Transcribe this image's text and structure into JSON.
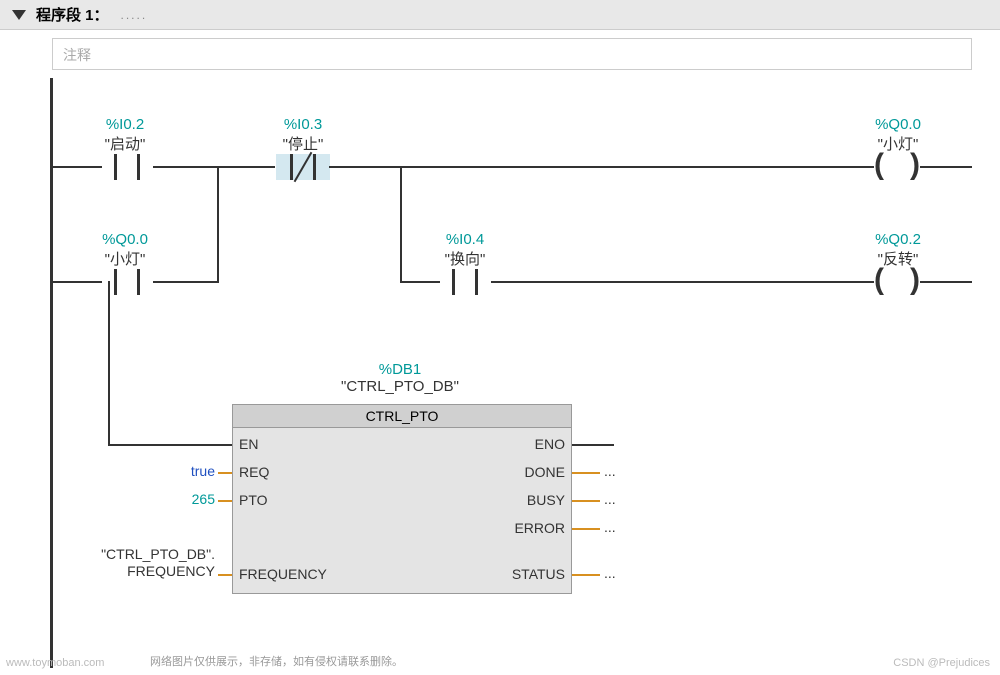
{
  "header": {
    "title": "程序段 1：",
    "dots": "....."
  },
  "comment_placeholder": "注释",
  "rung1": {
    "c1": {
      "addr": "%I0.2",
      "sym": "\"启动\""
    },
    "c2": {
      "addr": "%I0.3",
      "sym": "\"停止\""
    },
    "coil": {
      "addr": "%Q0.0",
      "sym": "\"小灯\""
    }
  },
  "rung2": {
    "c1": {
      "addr": "%Q0.0",
      "sym": "\"小灯\""
    },
    "c2": {
      "addr": "%I0.4",
      "sym": "\"换向\""
    },
    "coil": {
      "addr": "%Q0.2",
      "sym": "\"反转\""
    }
  },
  "fb": {
    "db_addr": "%DB1",
    "db_name": "\"CTRL_PTO_DB\"",
    "title": "CTRL_PTO",
    "inputs": [
      {
        "name": "EN",
        "val": "",
        "cls": ""
      },
      {
        "name": "REQ",
        "val": "true",
        "cls": "blue"
      },
      {
        "name": "PTO",
        "val": "265",
        "cls": "teal"
      },
      {
        "name": "FREQUENCY",
        "val": "\"CTRL_PTO_DB\".\nFREQUENCY",
        "cls": "black"
      }
    ],
    "outputs": [
      {
        "name": "ENO",
        "val": ""
      },
      {
        "name": "DONE",
        "val": "..."
      },
      {
        "name": "BUSY",
        "val": "..."
      },
      {
        "name": "ERROR",
        "val": "..."
      },
      {
        "name": "STATUS",
        "val": "..."
      }
    ]
  },
  "watermark_left": "www.toymoban.com",
  "watermark_note": "网络图片仅供展示，非存储，如有侵权请联系删除。",
  "watermark_right": "CSDN @Prejudices"
}
